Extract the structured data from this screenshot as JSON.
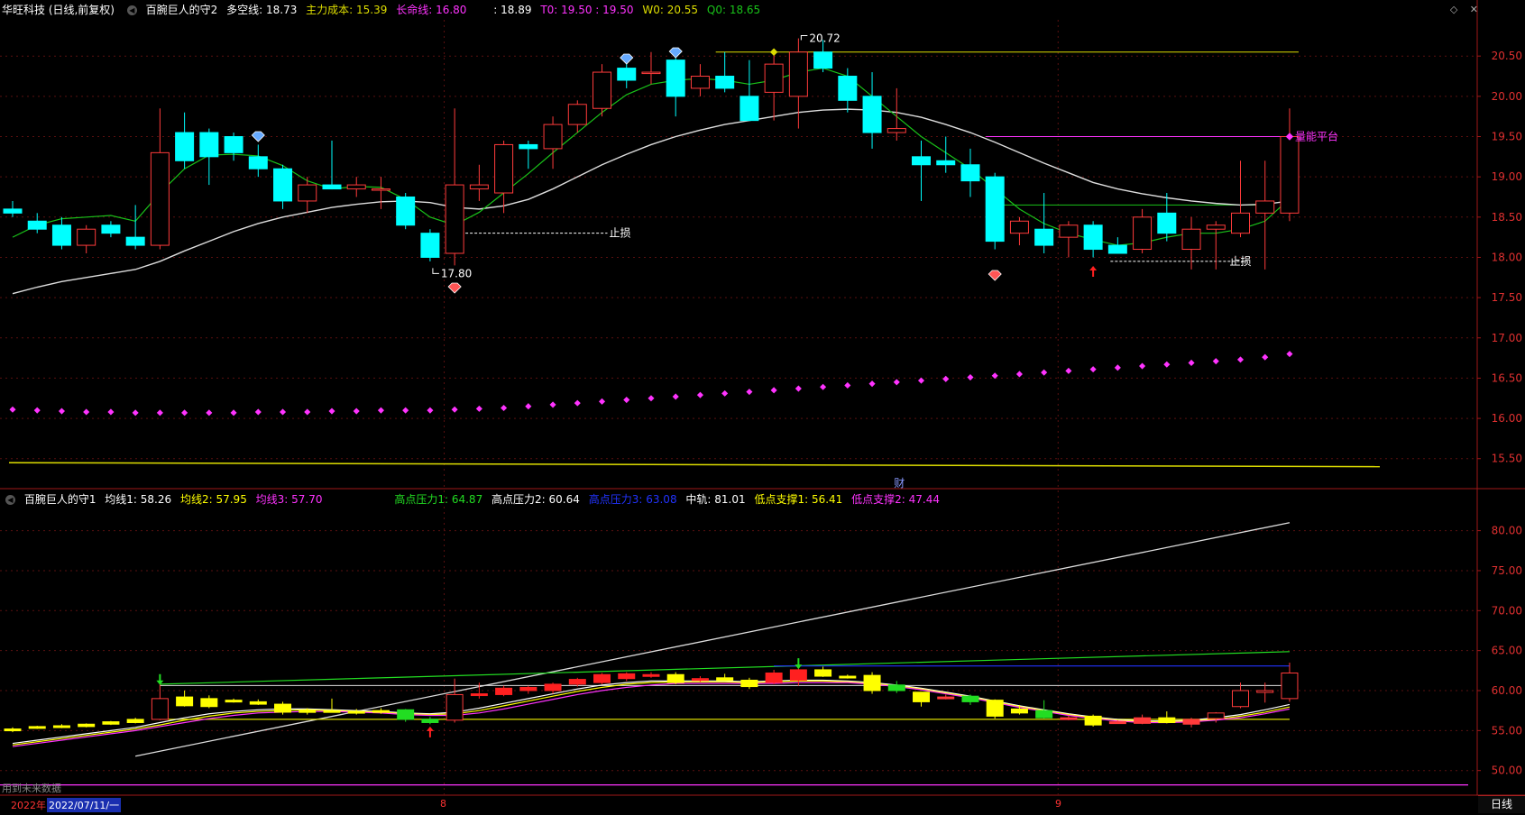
{
  "main_header": {
    "stock": "华旺科技 (日线,前复权)",
    "indicator": "百腕巨人的守2",
    "duokong": "多空线: 18.73",
    "zhuli": "主力成本: 15.39",
    "changming": "长命线: 16.80",
    "blank": ": 18.89",
    "t0": "T0: 19.50 : 19.50",
    "w0": "W0: 20.55",
    "q0": "Q0: 18.65"
  },
  "sub_header": {
    "indicator": "百腕巨人的守1",
    "ma1": "均线1: 58.26",
    "ma2": "均线2: 57.95",
    "ma3": "均线3: 57.70",
    "hp1": "高点压力1: 64.87",
    "hp2": "高点压力2: 60.64",
    "hp3": "高点压力3: 63.08",
    "mid": "中轨: 81.01",
    "ls1": "低点支撑1: 56.41",
    "ls2": "低点支撑2: 47.44"
  },
  "annotations": {
    "high": "20.72",
    "low": "17.80",
    "stop_loss": "止损",
    "stop_loss2": "止损",
    "platform": "量能平台",
    "cai": "财"
  },
  "footer": {
    "future_note": "用到未来数据",
    "year": "2022年",
    "date": "2022/07/11/一",
    "month8": "8",
    "month9": "9",
    "period": "日线"
  },
  "icons": {
    "diamond_btn": "diamond-icon",
    "close_btn": "close-icon"
  },
  "colors": {
    "up": "#ff3b3b",
    "down": "#00ffff",
    "ma_green": "#19c219",
    "ma_white": "#dddddd",
    "magenta": "#ff33ff",
    "yellow": "#dddd00",
    "axis_red": "#a01818",
    "sub_yellow": "#ffff00",
    "sub_green": "#22dd22",
    "sub_red": "#ff2020"
  },
  "chart_data": [
    {
      "type": "candlestick",
      "title": "华旺科技 日线",
      "y_ticks": [
        15.5,
        16.0,
        16.5,
        17.0,
        17.5,
        18.0,
        18.5,
        19.0,
        19.5,
        20.0,
        20.5
      ],
      "ylim": [
        15.15,
        20.95
      ],
      "candles": [
        {
          "o": 18.6,
          "h": 18.7,
          "l": 18.5,
          "c": 18.55
        },
        {
          "o": 18.45,
          "h": 18.55,
          "l": 18.3,
          "c": 18.35
        },
        {
          "o": 18.4,
          "h": 18.5,
          "l": 18.1,
          "c": 18.15
        },
        {
          "o": 18.15,
          "h": 18.4,
          "l": 18.05,
          "c": 18.35
        },
        {
          "o": 18.4,
          "h": 18.45,
          "l": 18.25,
          "c": 18.3
        },
        {
          "o": 18.25,
          "h": 18.65,
          "l": 18.1,
          "c": 18.15
        },
        {
          "o": 18.15,
          "h": 19.85,
          "l": 18.1,
          "c": 19.3
        },
        {
          "o": 19.55,
          "h": 19.8,
          "l": 19.1,
          "c": 19.2
        },
        {
          "o": 19.55,
          "h": 19.6,
          "l": 18.9,
          "c": 19.25
        },
        {
          "o": 19.5,
          "h": 19.55,
          "l": 19.2,
          "c": 19.3
        },
        {
          "o": 19.25,
          "h": 19.4,
          "l": 19.0,
          "c": 19.1
        },
        {
          "o": 19.1,
          "h": 19.15,
          "l": 18.6,
          "c": 18.7
        },
        {
          "o": 18.7,
          "h": 19.0,
          "l": 18.55,
          "c": 18.9
        },
        {
          "o": 18.9,
          "h": 19.45,
          "l": 18.85,
          "c": 18.85
        },
        {
          "o": 18.85,
          "h": 19.0,
          "l": 18.75,
          "c": 18.9
        },
        {
          "o": 18.85,
          "h": 19.0,
          "l": 18.6,
          "c": 18.85
        },
        {
          "o": 18.75,
          "h": 18.8,
          "l": 18.35,
          "c": 18.4
        },
        {
          "o": 18.3,
          "h": 18.35,
          "l": 17.95,
          "c": 18.0
        },
        {
          "o": 18.05,
          "h": 19.85,
          "l": 17.9,
          "c": 18.9
        },
        {
          "o": 18.85,
          "h": 19.15,
          "l": 18.7,
          "c": 18.9
        },
        {
          "o": 18.8,
          "h": 19.45,
          "l": 18.55,
          "c": 19.4
        },
        {
          "o": 19.4,
          "h": 19.45,
          "l": 19.1,
          "c": 19.35
        },
        {
          "o": 19.35,
          "h": 19.75,
          "l": 19.1,
          "c": 19.65
        },
        {
          "o": 19.65,
          "h": 19.95,
          "l": 19.55,
          "c": 19.9
        },
        {
          "o": 19.85,
          "h": 20.4,
          "l": 19.75,
          "c": 20.3
        },
        {
          "o": 20.35,
          "h": 20.5,
          "l": 20.1,
          "c": 20.2
        },
        {
          "o": 20.3,
          "h": 20.55,
          "l": 20.15,
          "c": 20.3
        },
        {
          "o": 20.45,
          "h": 20.6,
          "l": 19.75,
          "c": 20.0
        },
        {
          "o": 20.1,
          "h": 20.4,
          "l": 20.0,
          "c": 20.25
        },
        {
          "o": 20.25,
          "h": 20.55,
          "l": 20.05,
          "c": 20.1
        },
        {
          "o": 20.0,
          "h": 20.45,
          "l": 19.8,
          "c": 19.7
        },
        {
          "o": 20.05,
          "h": 20.55,
          "l": 19.7,
          "c": 20.4
        },
        {
          "o": 20.0,
          "h": 20.72,
          "l": 19.6,
          "c": 20.55
        },
        {
          "o": 20.55,
          "h": 20.7,
          "l": 20.3,
          "c": 20.35
        },
        {
          "o": 20.25,
          "h": 20.35,
          "l": 19.8,
          "c": 19.95
        },
        {
          "o": 20.0,
          "h": 20.3,
          "l": 19.35,
          "c": 19.55
        },
        {
          "o": 19.55,
          "h": 20.1,
          "l": 19.45,
          "c": 19.6
        },
        {
          "o": 19.25,
          "h": 19.45,
          "l": 18.7,
          "c": 19.15
        },
        {
          "o": 19.2,
          "h": 19.5,
          "l": 19.05,
          "c": 19.15
        },
        {
          "o": 19.15,
          "h": 19.35,
          "l": 18.75,
          "c": 18.95
        },
        {
          "o": 19.0,
          "h": 19.05,
          "l": 18.1,
          "c": 18.2
        },
        {
          "o": 18.3,
          "h": 18.5,
          "l": 18.15,
          "c": 18.45
        },
        {
          "o": 18.35,
          "h": 18.8,
          "l": 18.05,
          "c": 18.15
        },
        {
          "o": 18.25,
          "h": 18.45,
          "l": 18.0,
          "c": 18.4
        },
        {
          "o": 18.4,
          "h": 18.45,
          "l": 18.0,
          "c": 18.1
        },
        {
          "o": 18.15,
          "h": 18.25,
          "l": 18.05,
          "c": 18.05
        },
        {
          "o": 18.1,
          "h": 18.6,
          "l": 18.05,
          "c": 18.5
        },
        {
          "o": 18.55,
          "h": 18.8,
          "l": 18.2,
          "c": 18.3
        },
        {
          "o": 18.1,
          "h": 18.5,
          "l": 17.85,
          "c": 18.35
        },
        {
          "o": 18.35,
          "h": 18.45,
          "l": 17.85,
          "c": 18.4
        },
        {
          "o": 18.3,
          "h": 19.2,
          "l": 18.25,
          "c": 18.55
        },
        {
          "o": 18.55,
          "h": 19.2,
          "l": 17.85,
          "c": 18.7
        },
        {
          "o": 18.55,
          "h": 19.85,
          "l": 18.45,
          "c": 19.5
        }
      ],
      "ma_green": [
        18.25,
        18.4,
        18.48,
        18.5,
        18.52,
        18.45,
        18.8,
        19.1,
        19.27,
        19.28,
        19.26,
        19.14,
        18.95,
        18.85,
        18.88,
        18.87,
        18.72,
        18.5,
        18.4,
        18.56,
        18.8,
        19.04,
        19.3,
        19.55,
        19.8,
        20.02,
        20.15,
        20.2,
        20.22,
        20.2,
        20.15,
        20.2,
        20.3,
        20.35,
        20.25,
        20.0,
        19.75,
        19.5,
        19.3,
        19.1,
        18.85,
        18.6,
        18.42,
        18.3,
        18.22,
        18.15,
        18.18,
        18.25,
        18.3,
        18.3,
        18.35,
        18.45,
        18.73
      ],
      "ma_white": [
        17.55,
        17.63,
        17.7,
        17.75,
        17.8,
        17.85,
        17.95,
        18.08,
        18.2,
        18.32,
        18.42,
        18.5,
        18.56,
        18.62,
        18.66,
        18.69,
        18.7,
        18.68,
        18.62,
        18.6,
        18.64,
        18.72,
        18.85,
        19.0,
        19.15,
        19.28,
        19.4,
        19.5,
        19.58,
        19.65,
        19.7,
        19.75,
        19.8,
        19.83,
        19.84,
        19.83,
        19.8,
        19.74,
        19.65,
        19.55,
        19.43,
        19.3,
        19.17,
        19.05,
        18.93,
        18.85,
        18.79,
        18.74,
        18.7,
        18.67,
        18.65,
        18.66,
        18.7
      ],
      "dots": [
        16.11,
        16.1,
        16.09,
        16.08,
        16.08,
        16.07,
        16.07,
        16.07,
        16.07,
        16.07,
        16.08,
        16.08,
        16.08,
        16.09,
        16.09,
        16.1,
        16.1,
        16.1,
        16.11,
        16.12,
        16.13,
        16.15,
        16.17,
        16.19,
        16.21,
        16.23,
        16.25,
        16.27,
        16.29,
        16.31,
        16.33,
        16.35,
        16.37,
        16.39,
        16.41,
        16.43,
        16.45,
        16.47,
        16.49,
        16.51,
        16.53,
        16.55,
        16.57,
        16.59,
        16.61,
        16.63,
        16.65,
        16.67,
        16.69,
        16.71,
        16.73,
        16.76,
        16.8
      ],
      "zhuli_cost": [
        15.39,
        15.39
      ],
      "resistance_w0": 20.55,
      "stop_loss_1": 18.3,
      "stop_loss_2": 17.95,
      "platform": 19.5,
      "support_q0": 18.65,
      "annot_high": 20.72,
      "annot_low": 17.8
    },
    {
      "type": "candlestick",
      "title": "百腕巨人的守1",
      "y_ticks": [
        50.0,
        55.0,
        60.0,
        65.0,
        70.0,
        75.0,
        80.0
      ],
      "ylim": [
        48.5,
        83.0
      ],
      "candles": [
        {
          "o": 55.0,
          "h": 55.4,
          "l": 54.8,
          "c": 55.2
        },
        {
          "o": 55.3,
          "h": 55.6,
          "l": 55.2,
          "c": 55.5
        },
        {
          "o": 55.4,
          "h": 55.8,
          "l": 55.3,
          "c": 55.6
        },
        {
          "o": 55.5,
          "h": 55.9,
          "l": 55.4,
          "c": 55.8
        },
        {
          "o": 55.8,
          "h": 56.2,
          "l": 55.7,
          "c": 56.1
        },
        {
          "o": 56.0,
          "h": 56.6,
          "l": 55.9,
          "c": 56.4
        },
        {
          "o": 56.4,
          "h": 61.0,
          "l": 56.3,
          "c": 59.0
        },
        {
          "o": 59.2,
          "h": 60.0,
          "l": 58.0,
          "c": 58.1
        },
        {
          "o": 59.0,
          "h": 59.4,
          "l": 57.8,
          "c": 58.0
        },
        {
          "o": 58.8,
          "h": 59.0,
          "l": 58.5,
          "c": 58.7
        },
        {
          "o": 58.6,
          "h": 58.9,
          "l": 58.2,
          "c": 58.3
        },
        {
          "o": 58.3,
          "h": 58.6,
          "l": 57.0,
          "c": 57.3
        },
        {
          "o": 57.3,
          "h": 57.8,
          "l": 57.0,
          "c": 57.5
        },
        {
          "o": 57.5,
          "h": 59.0,
          "l": 57.4,
          "c": 57.5
        },
        {
          "o": 57.3,
          "h": 57.7,
          "l": 57.0,
          "c": 57.4
        },
        {
          "o": 57.4,
          "h": 57.8,
          "l": 57.1,
          "c": 57.5
        },
        {
          "o": 57.6,
          "h": 57.7,
          "l": 56.1,
          "c": 56.4
        },
        {
          "o": 56.4,
          "h": 56.7,
          "l": 55.8,
          "c": 56.0
        },
        {
          "o": 56.3,
          "h": 61.5,
          "l": 56.0,
          "c": 59.5
        },
        {
          "o": 59.4,
          "h": 61.0,
          "l": 59.0,
          "c": 59.6
        },
        {
          "o": 59.5,
          "h": 60.6,
          "l": 59.3,
          "c": 60.3
        },
        {
          "o": 60.0,
          "h": 60.6,
          "l": 59.6,
          "c": 60.4
        },
        {
          "o": 60.0,
          "h": 61.0,
          "l": 59.6,
          "c": 60.8
        },
        {
          "o": 60.8,
          "h": 61.6,
          "l": 60.5,
          "c": 61.4
        },
        {
          "o": 61.0,
          "h": 62.2,
          "l": 60.8,
          "c": 62.0
        },
        {
          "o": 61.5,
          "h": 62.3,
          "l": 61.2,
          "c": 62.1
        },
        {
          "o": 61.8,
          "h": 62.3,
          "l": 61.6,
          "c": 62.0
        },
        {
          "o": 62.0,
          "h": 62.3,
          "l": 60.8,
          "c": 61.0
        },
        {
          "o": 61.4,
          "h": 61.8,
          "l": 61.1,
          "c": 61.5
        },
        {
          "o": 61.6,
          "h": 62.1,
          "l": 61.4,
          "c": 61.3
        },
        {
          "o": 61.3,
          "h": 61.6,
          "l": 60.2,
          "c": 60.5
        },
        {
          "o": 61.0,
          "h": 62.6,
          "l": 60.8,
          "c": 62.2
        },
        {
          "o": 61.3,
          "h": 62.9,
          "l": 60.6,
          "c": 62.6
        },
        {
          "o": 62.6,
          "h": 63.0,
          "l": 61.7,
          "c": 61.8
        },
        {
          "o": 61.8,
          "h": 62.0,
          "l": 61.5,
          "c": 61.6
        },
        {
          "o": 61.9,
          "h": 62.3,
          "l": 59.6,
          "c": 60.0
        },
        {
          "o": 60.7,
          "h": 61.2,
          "l": 59.7,
          "c": 60.0
        },
        {
          "o": 59.8,
          "h": 59.8,
          "l": 58.0,
          "c": 58.6
        },
        {
          "o": 59.2,
          "h": 59.5,
          "l": 58.9,
          "c": 59.2
        },
        {
          "o": 59.3,
          "h": 59.5,
          "l": 58.2,
          "c": 58.6
        },
        {
          "o": 58.8,
          "h": 58.9,
          "l": 56.5,
          "c": 56.8
        },
        {
          "o": 57.7,
          "h": 58.2,
          "l": 57.0,
          "c": 57.2
        },
        {
          "o": 57.5,
          "h": 58.8,
          "l": 56.5,
          "c": 56.6
        },
        {
          "o": 56.5,
          "h": 56.9,
          "l": 56.3,
          "c": 56.6
        },
        {
          "o": 56.8,
          "h": 57.0,
          "l": 55.5,
          "c": 55.7
        },
        {
          "o": 56.0,
          "h": 56.3,
          "l": 55.9,
          "c": 56.1
        },
        {
          "o": 55.9,
          "h": 57.0,
          "l": 55.8,
          "c": 56.6
        },
        {
          "o": 56.6,
          "h": 57.4,
          "l": 55.9,
          "c": 56.0
        },
        {
          "o": 55.8,
          "h": 56.6,
          "l": 55.4,
          "c": 56.4
        },
        {
          "o": 56.5,
          "h": 57.3,
          "l": 56.0,
          "c": 57.2
        },
        {
          "o": 58.0,
          "h": 61.0,
          "l": 57.8,
          "c": 60.0
        },
        {
          "o": 60.0,
          "h": 61.0,
          "l": 58.5,
          "c": 60.0
        },
        {
          "o": 59.0,
          "h": 63.5,
          "l": 58.6,
          "c": 62.2
        }
      ],
      "ma_lines": [
        [
          53.4,
          53.8,
          54.2,
          54.6,
          55.0,
          55.4,
          56.0,
          56.6,
          57.1,
          57.4,
          57.6,
          57.7,
          57.7,
          57.6,
          57.5,
          57.4,
          57.2,
          57.1,
          57.3,
          57.8,
          58.4,
          59.0,
          59.6,
          60.2,
          60.7,
          61.0,
          61.2,
          61.2,
          61.2,
          61.2,
          61.1,
          61.2,
          61.3,
          61.3,
          61.2,
          61.0,
          60.7,
          60.3,
          59.8,
          59.3,
          58.7,
          58.1,
          57.6,
          57.1,
          56.7,
          56.4,
          56.2,
          56.2,
          56.3,
          56.6,
          57.0,
          57.6,
          58.26
        ],
        [
          53.2,
          53.6,
          54.0,
          54.4,
          54.8,
          55.2,
          55.7,
          56.3,
          56.8,
          57.2,
          57.4,
          57.5,
          57.6,
          57.5,
          57.4,
          57.3,
          57.1,
          57.0,
          57.1,
          57.5,
          58.1,
          58.7,
          59.3,
          59.9,
          60.4,
          60.8,
          61.0,
          61.1,
          61.1,
          61.1,
          61.0,
          61.1,
          61.2,
          61.2,
          61.1,
          60.9,
          60.6,
          60.2,
          59.7,
          59.2,
          58.6,
          58.0,
          57.5,
          57.0,
          56.6,
          56.3,
          56.1,
          56.1,
          56.2,
          56.4,
          56.8,
          57.3,
          57.95
        ],
        [
          53.0,
          53.4,
          53.8,
          54.2,
          54.6,
          55.0,
          55.5,
          56.0,
          56.5,
          56.9,
          57.2,
          57.3,
          57.4,
          57.4,
          57.3,
          57.2,
          57.0,
          56.9,
          56.9,
          57.2,
          57.7,
          58.3,
          58.9,
          59.5,
          60.0,
          60.4,
          60.7,
          60.9,
          60.9,
          60.9,
          60.9,
          60.9,
          61.0,
          61.0,
          61.0,
          60.8,
          60.5,
          60.1,
          59.6,
          59.1,
          58.5,
          57.9,
          57.4,
          56.9,
          56.5,
          56.2,
          56.0,
          56.0,
          56.1,
          56.3,
          56.6,
          57.1,
          57.7
        ]
      ],
      "midline": {
        "from": [
          5,
          51.8
        ],
        "to": [
          52,
          81.0
        ]
      },
      "hp1": {
        "from": [
          6,
          60.8
        ],
        "to": [
          52,
          64.87
        ]
      },
      "hp2": 60.64,
      "hp3": {
        "from": [
          31,
          63.08
        ],
        "to": [
          52,
          63.08
        ]
      },
      "ls1": 56.41,
      "ls2": 47.44
    }
  ]
}
